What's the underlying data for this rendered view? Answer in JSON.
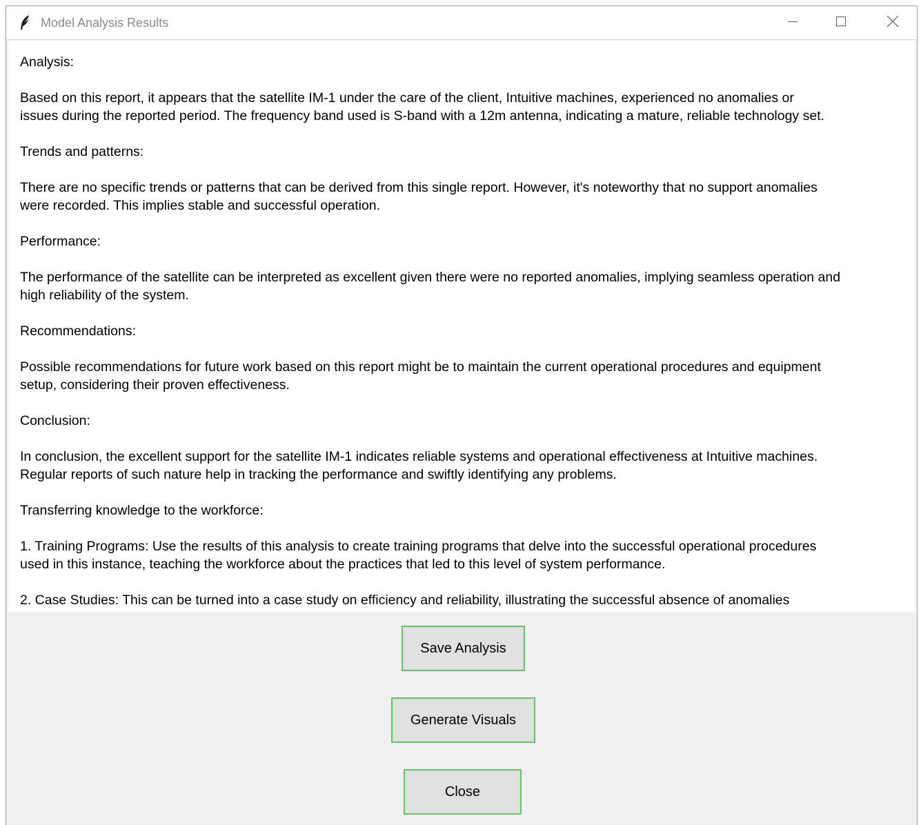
{
  "window": {
    "title": "Model Analysis Results",
    "icons": {
      "app": "feather-icon",
      "minimize": "minimize-icon",
      "maximize": "maximize-icon",
      "close": "close-icon"
    }
  },
  "content": {
    "paragraphs": [
      "Analysis:",
      "Based on this report, it appears that the satellite IM-1 under the care of the client, Intuitive machines, experienced no anomalies or\nissues during the reported period. The frequency band used is S-band with a 12m antenna, indicating a mature, reliable technology set.",
      "Trends and patterns:",
      "There are no specific trends or patterns that can be derived from this single report. However, it's noteworthy that no support anomalies\nwere recorded. This implies stable and successful operation.",
      "Performance:",
      "The performance of the satellite can be interpreted as excellent given there were no reported anomalies, implying seamless operation and\nhigh reliability of the system.",
      "Recommendations:",
      "Possible recommendations for future work based on this report might be to maintain the current operational procedures and equipment\nsetup, considering their proven effectiveness.",
      "Conclusion:",
      "In conclusion, the excellent support for the satellite IM-1 indicates reliable systems and operational effectiveness at Intuitive machines.\nRegular reports of such nature help in tracking the performance and swiftly identifying any problems.",
      "Transferring knowledge to the workforce:",
      "1. Training Programs: Use the results of this analysis to create training programs that delve into the successful operational procedures\nused in this instance, teaching the workforce about the practices that led to this level of system performance.",
      "2. Case Studies: This can be turned into a case study on efficiency and reliability, illustrating the successful absence of anomalies"
    ]
  },
  "buttons": {
    "save": "Save Analysis",
    "visuals": "Generate Visuals",
    "close": "Close"
  },
  "colors": {
    "button_border": "#6dbb6d",
    "button_bg": "#e1e1e1",
    "window_bg": "#f0f0f0"
  }
}
